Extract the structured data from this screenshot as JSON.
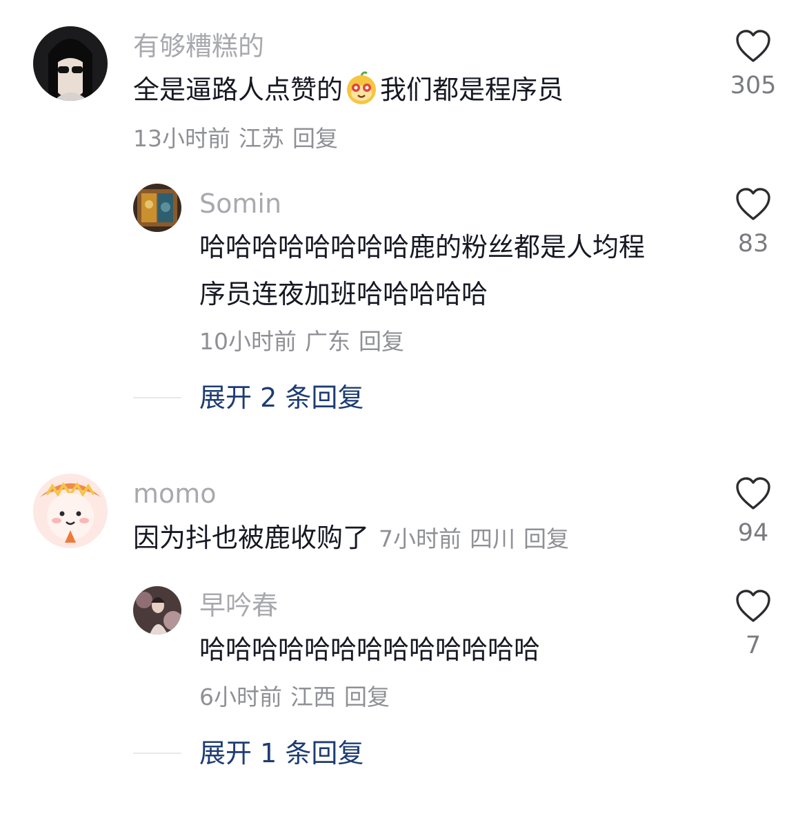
{
  "comments": [
    {
      "username": "有够糟糕的",
      "text_before": "全是逼路人点赞的",
      "emoji": "monkey-face-emoji",
      "text_after": "我们都是程序员",
      "time": "13小时前",
      "location": "江苏",
      "reply": "回复",
      "likes": "305"
    },
    {
      "username": "Somin",
      "text_line1": "哈哈哈哈哈哈哈哈鹿的粉丝都是人均程",
      "text_line2": "序员连夜加班哈哈哈哈哈",
      "time": "10小时前",
      "location": "广东",
      "reply": "回复",
      "likes": "83"
    },
    {
      "expand": "展开 2 条回复"
    },
    {
      "username": "momo",
      "text": "因为抖也被鹿收购了",
      "time": "7小时前",
      "location": "四川",
      "reply": "回复",
      "likes": "94"
    },
    {
      "username": "早吟春",
      "text": "哈哈哈哈哈哈哈哈哈哈哈哈哈",
      "time": "6小时前",
      "location": "江西",
      "reply": "回复",
      "likes": "7"
    },
    {
      "expand": "展开 1 条回复"
    }
  ],
  "icons": {
    "like": "heart-outline-icon"
  },
  "colors": {
    "text": "#161823",
    "secondary": "#8f9095",
    "link": "#1d3c73"
  }
}
